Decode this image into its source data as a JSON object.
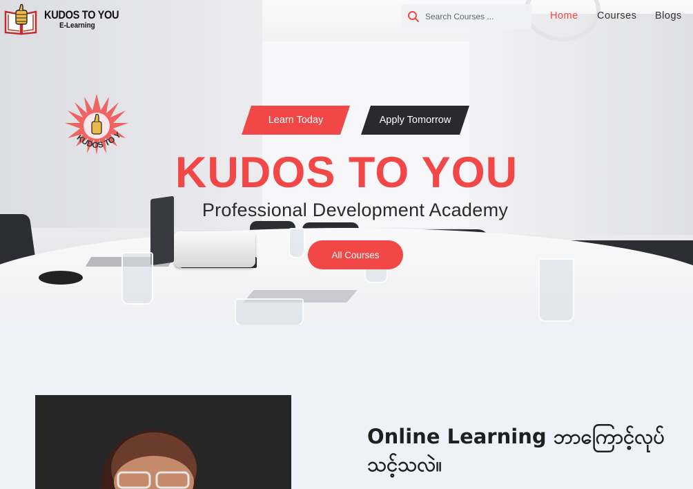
{
  "header": {
    "logo_title": "KUDOS TO YOU",
    "logo_subtitle": "E-Learning",
    "search_placeholder": "Search Courses ...",
    "nav": [
      {
        "label": "Home",
        "active": true
      },
      {
        "label": "Courses",
        "active": false
      },
      {
        "label": "Blogs",
        "active": false
      }
    ]
  },
  "hero": {
    "badge_text": "KUDOS TO YOU",
    "pill_left": "Learn Today",
    "pill_right": "Apply Tomorrow",
    "title": "KUDOS TO YOU",
    "subtitle": "Professional Development Academy",
    "cta_label": "All Courses"
  },
  "section": {
    "heading": "Online Learning ဘာကြောင့်လုပ်သင့်သလဲ။"
  },
  "colors": {
    "accent": "#f24747",
    "dark": "#2a2a2e",
    "section_bg": "#eef2f8"
  },
  "icons": {
    "search": "search-icon",
    "logo": "book-thumbs-up-icon",
    "badge": "thumbs-up-burst-icon"
  }
}
